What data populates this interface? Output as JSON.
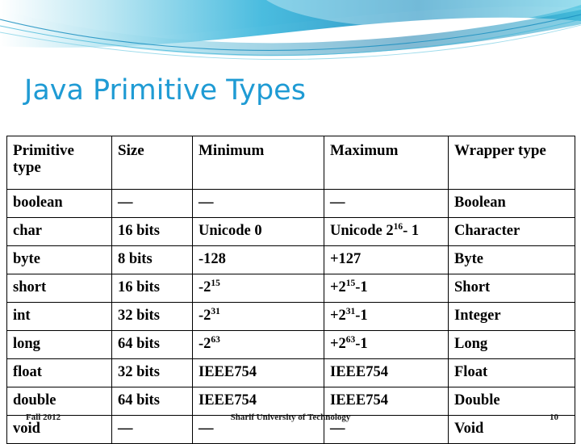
{
  "slide": {
    "title": "Java Primitive Types",
    "accent_color": "#1f9bd4"
  },
  "table": {
    "headers": [
      "Primitive type",
      "Size",
      "Minimum",
      "Maximum",
      "Wrapper type"
    ],
    "rows": [
      {
        "type": "boolean",
        "size": "—",
        "min": "—",
        "max": "—",
        "wrapper": "Boolean"
      },
      {
        "type": "char",
        "size": "16 bits",
        "min": "Unicode 0",
        "max_prefix": "Unicode 2",
        "max_sup": "16",
        "max_suffix": "- 1",
        "wrapper": "Character"
      },
      {
        "type": "byte",
        "size": "8 bits",
        "min": "-128",
        "max": "+127",
        "wrapper": "Byte"
      },
      {
        "type": "short",
        "size": "16 bits",
        "min_prefix": "-2",
        "min_sup": "15",
        "max_prefix": "+2",
        "max_sup": "15",
        "max_suffix": "-1",
        "wrapper": "Short"
      },
      {
        "type": "int",
        "size": "32 bits",
        "min_prefix": "-2",
        "min_sup": "31",
        "max_prefix": "+2",
        "max_sup": "31",
        "max_suffix": "-1",
        "wrapper": "Integer"
      },
      {
        "type": "long",
        "size": "64 bits",
        "min_prefix": "-2",
        "min_sup": "63",
        "max_prefix": "+2",
        "max_sup": "63",
        "max_suffix": "-1",
        "wrapper": "Long"
      },
      {
        "type": "float",
        "size": "32 bits",
        "min": "IEEE754",
        "max": "IEEE754",
        "wrapper": "Float"
      },
      {
        "type": "double",
        "size": "64 bits",
        "min": "IEEE754",
        "max": "IEEE754",
        "wrapper": "Double"
      },
      {
        "type": "void",
        "size": "—",
        "min": "—",
        "max": "—",
        "wrapper": "Void"
      }
    ]
  },
  "footer": {
    "date": "Fall 2012",
    "organization": "Sharif University of Technology",
    "page_number": "10"
  }
}
